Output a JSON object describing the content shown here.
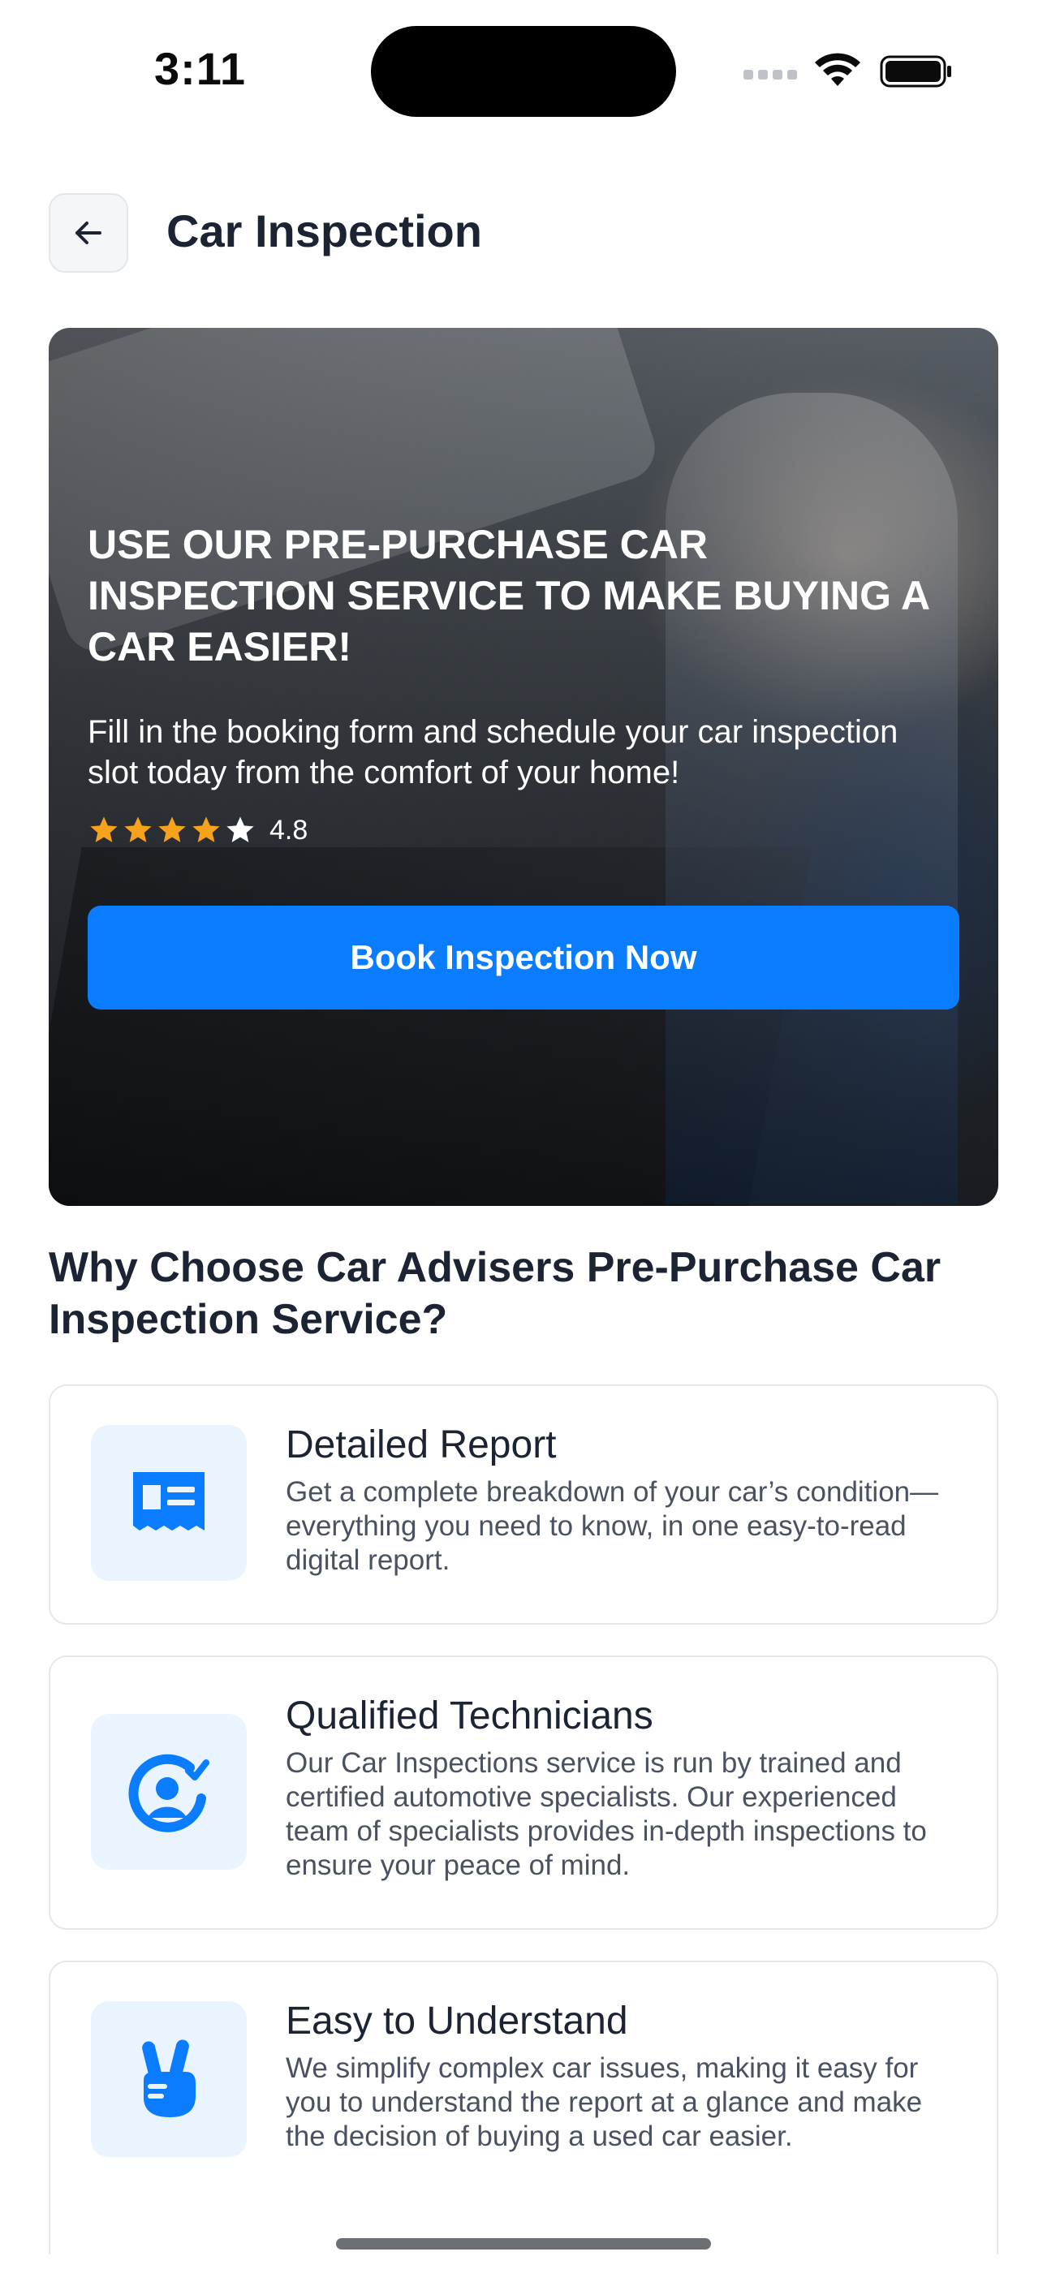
{
  "status_bar": {
    "time": "3:11"
  },
  "header": {
    "title": "Car Inspection"
  },
  "hero": {
    "title": "USE OUR PRE-PURCHASE CAR INSPECTION SERVICE TO MAKE BUYING A CAR EASIER!",
    "subtitle": "Fill in the booking form and schedule your car inspection slot today from the comfort of your home!",
    "rating": {
      "value": "4.8",
      "stars_filled": 4,
      "stars_total": 5
    },
    "cta_label": "Book Inspection Now"
  },
  "why": {
    "title": "Why Choose Car Advisers Pre-Purchase Car Inspection Service?",
    "features": [
      {
        "icon": "report-icon",
        "title": "Detailed Report",
        "desc": "Get a complete breakdown of your car’s condition—everything you need to know, in one easy-to-read digital report."
      },
      {
        "icon": "technician-icon",
        "title": "Qualified Technicians",
        "desc": "Our Car Inspections service is run by trained and certified automotive specialists. Our experienced team of specialists provides in-depth inspections to ensure your peace of mind."
      },
      {
        "icon": "peace-hand-icon",
        "title": "Easy to Understand",
        "desc": "We simplify complex car issues, making it easy for you to understand the report at a glance and make the decision of buying a used car easier."
      }
    ]
  },
  "colors": {
    "accent": "#0a7cff",
    "icon_bg": "#eaf4ff",
    "star": "#f7a21b",
    "text": "#1c2434"
  }
}
